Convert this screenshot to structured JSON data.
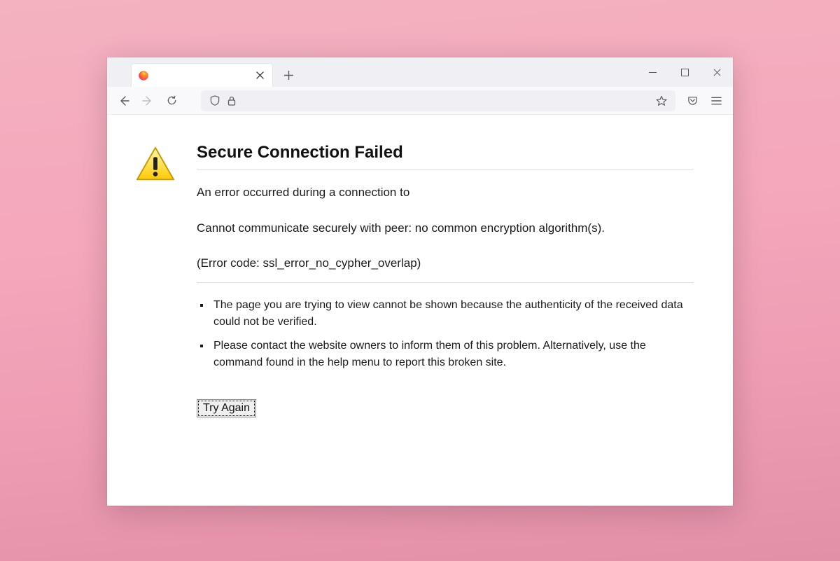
{
  "window": {
    "tab_title": ""
  },
  "error": {
    "title": "Secure Connection Failed",
    "line1": "An error occurred during a connection to",
    "line2": "Cannot communicate securely with peer: no common encryption algorithm(s).",
    "line3": "(Error code: ssl_error_no_cypher_overlap)",
    "bullet1": "The page you are trying to view cannot be shown because the authenticity of the received data could not be verified.",
    "bullet2": "Please contact the website owners to inform them of this problem. Alternatively, use the command found in the help menu to report this broken site.",
    "button": "Try Again"
  }
}
